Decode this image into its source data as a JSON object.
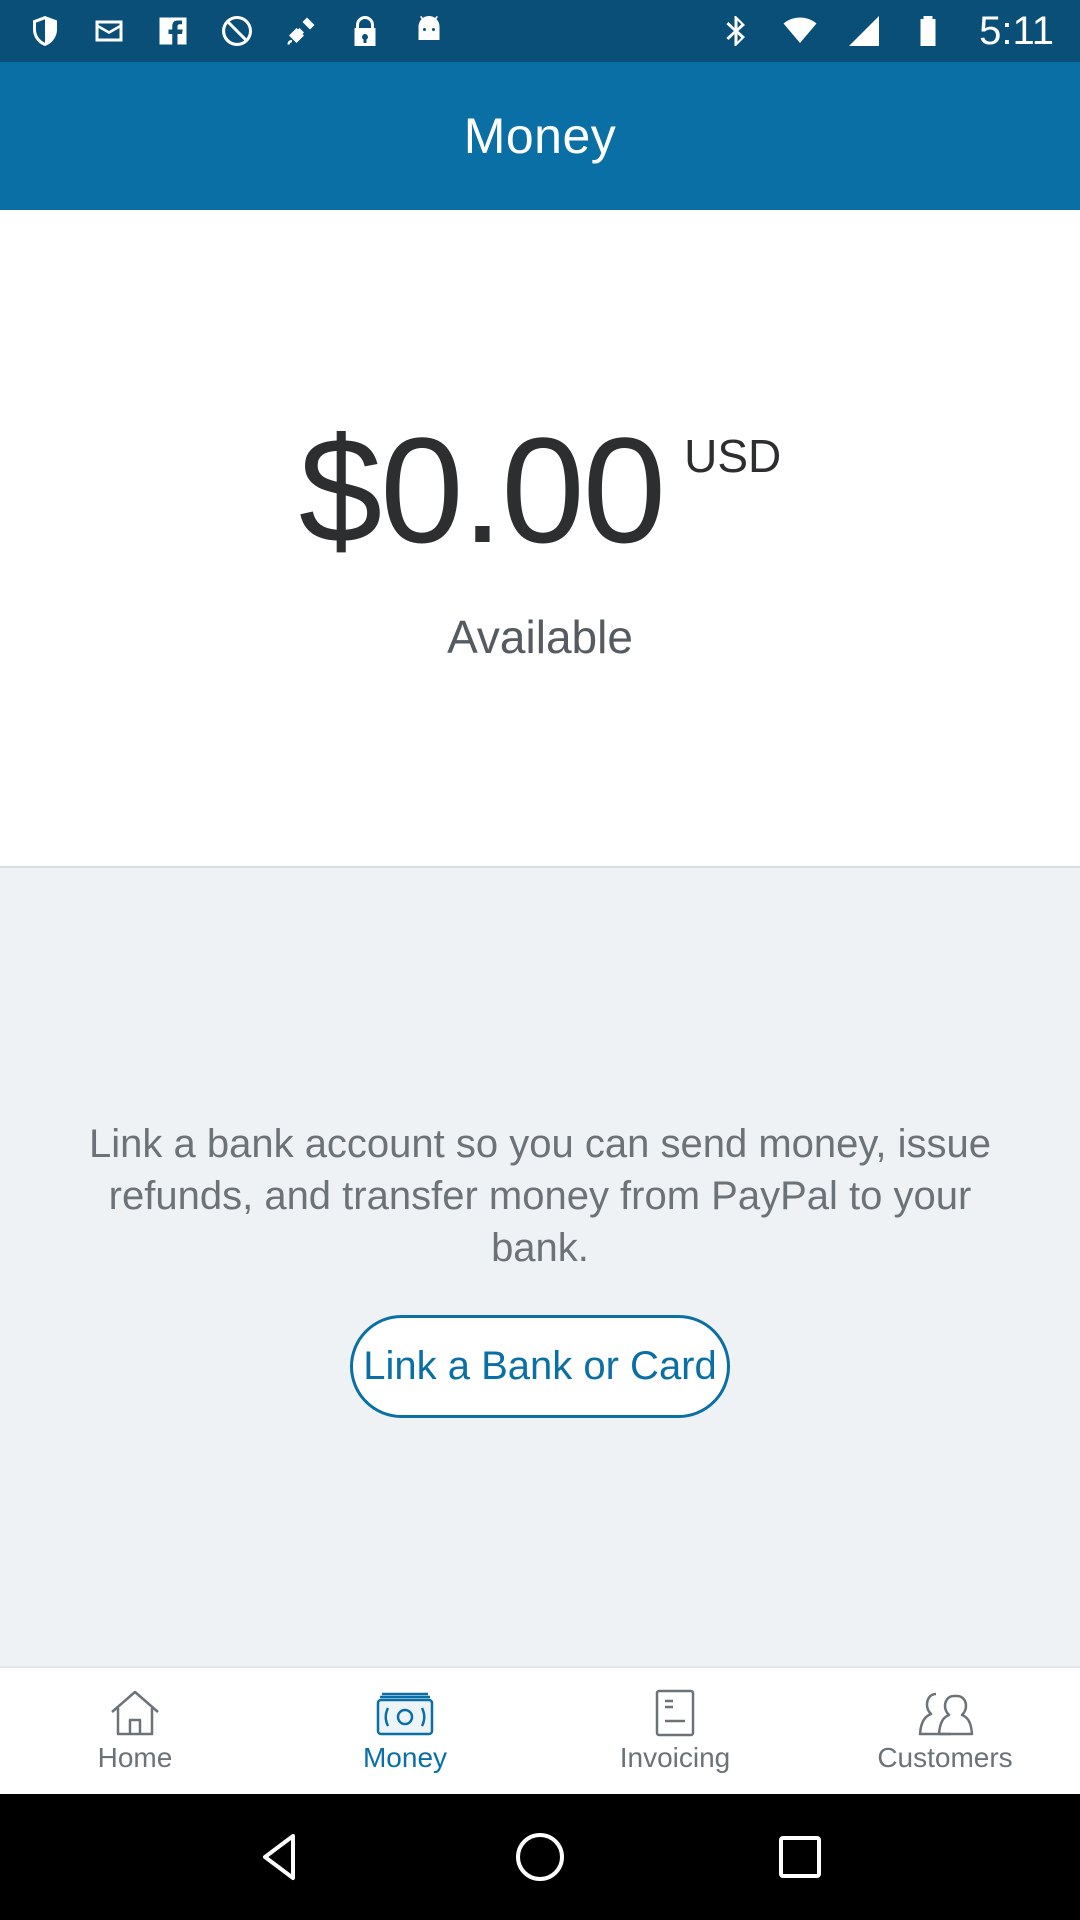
{
  "status_bar": {
    "time": "5:11",
    "left_icons": [
      "shield-icon",
      "mail-icon",
      "facebook-icon",
      "block-icon",
      "satellite-icon",
      "lock-icon",
      "android-icon"
    ],
    "right_icons": [
      "bluetooth-icon",
      "wifi-icon",
      "signal-icon",
      "battery-icon"
    ]
  },
  "header": {
    "title": "Money"
  },
  "balance": {
    "amount": "$0.00",
    "currency": "USD",
    "label": "Available"
  },
  "link_bank": {
    "message": "Link a bank account so you can send money, issue refunds, and transfer money from PayPal to your bank.",
    "button_label": "Link a Bank or Card"
  },
  "bottom_nav": {
    "items": [
      {
        "label": "Home",
        "icon": "home-icon",
        "active": false
      },
      {
        "label": "Money",
        "icon": "money-icon",
        "active": true
      },
      {
        "label": "Invoicing",
        "icon": "invoice-icon",
        "active": false
      },
      {
        "label": "Customers",
        "icon": "customers-icon",
        "active": false
      }
    ]
  },
  "colors": {
    "status_bar": "#0a4f78",
    "header": "#0a6fa5",
    "accent": "#0a6fa5",
    "section_bg": "#eef2f5"
  }
}
